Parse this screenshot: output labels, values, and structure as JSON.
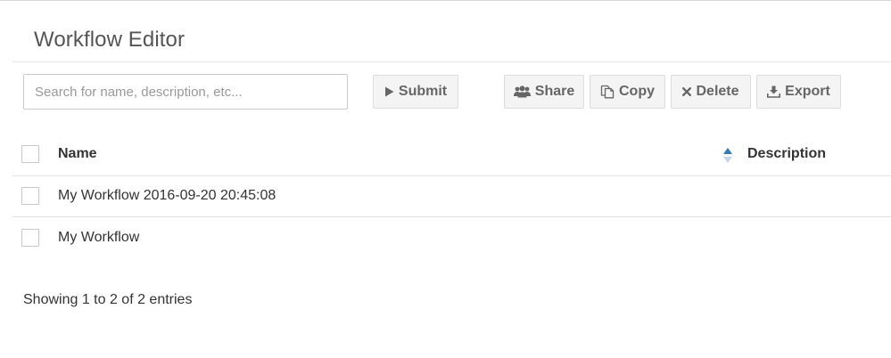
{
  "page": {
    "title": "Workflow Editor"
  },
  "search": {
    "placeholder": "Search for name, description, etc...",
    "value": ""
  },
  "toolbar": {
    "submit_label": "Submit",
    "share_label": "Share",
    "copy_label": "Copy",
    "delete_label": "Delete",
    "export_label": "Export",
    "icons": {
      "submit": "play-icon",
      "share": "users-icon",
      "copy": "copy-icon",
      "delete": "close-icon",
      "export": "download-icon"
    }
  },
  "table": {
    "columns": {
      "name": "Name",
      "description": "Description"
    },
    "sort": {
      "column": "name",
      "direction": "ascending",
      "active_color": "#337ab7",
      "inactive_color": "#c5d6e8"
    },
    "rows": [
      {
        "name": "My Workflow 2016-09-20 20:45:08",
        "description": "",
        "checked": false
      },
      {
        "name": "My Workflow",
        "description": "",
        "checked": false
      }
    ]
  },
  "footer": {
    "info": "Showing 1 to 2 of 2 entries"
  }
}
